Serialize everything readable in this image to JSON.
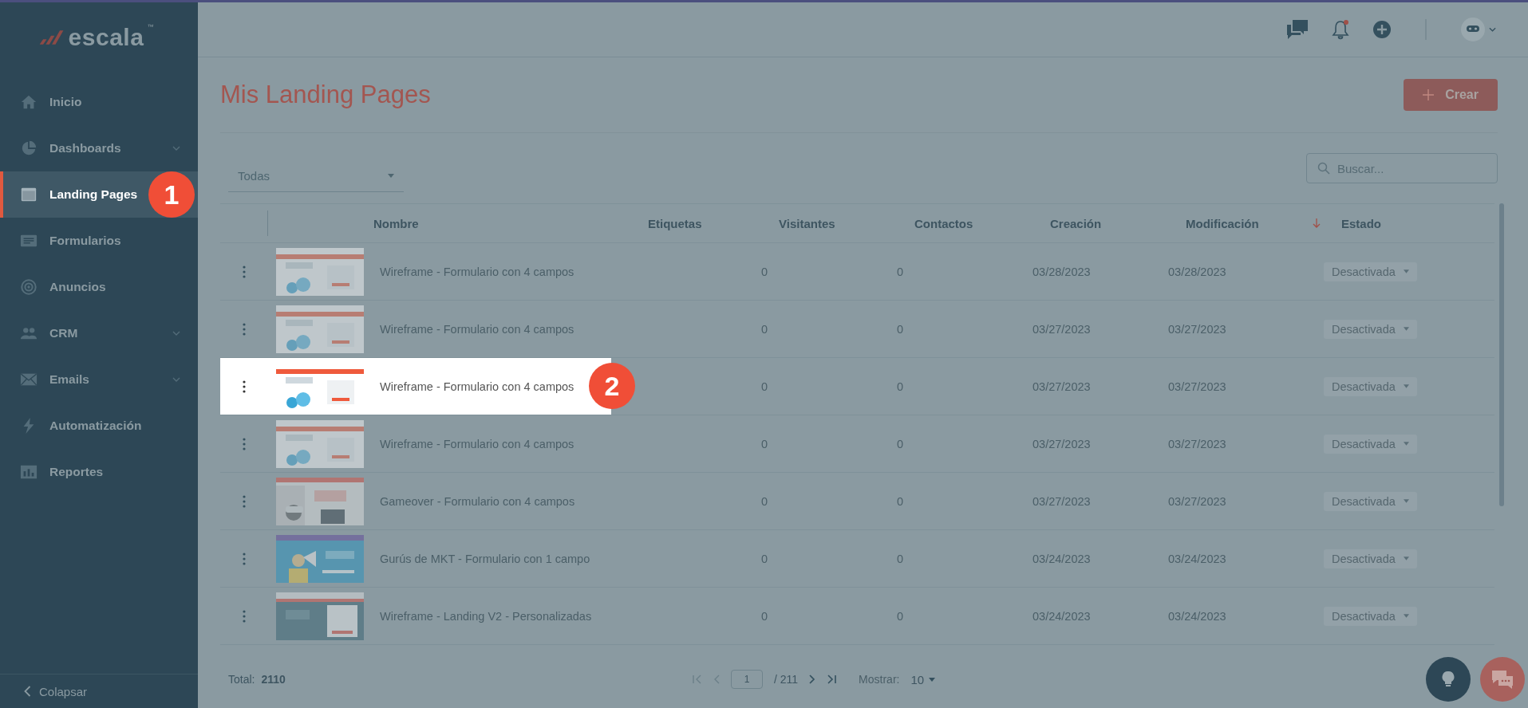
{
  "logo": {
    "text": "escala",
    "mark": "™"
  },
  "sidebar": {
    "items": [
      {
        "label": "Inicio",
        "expandable": false,
        "selected": false
      },
      {
        "label": "Dashboards",
        "expandable": true,
        "selected": false
      },
      {
        "label": "Landing Pages",
        "expandable": false,
        "selected": true
      },
      {
        "label": "Formularios",
        "expandable": false,
        "selected": false
      },
      {
        "label": "Anuncios",
        "expandable": false,
        "selected": false
      },
      {
        "label": "CRM",
        "expandable": true,
        "selected": false
      },
      {
        "label": "Emails",
        "expandable": true,
        "selected": false
      },
      {
        "label": "Automatización",
        "expandable": false,
        "selected": false
      },
      {
        "label": "Reportes",
        "expandable": false,
        "selected": false
      }
    ],
    "collapse": "Colapsar"
  },
  "callouts": [
    "1",
    "2"
  ],
  "page_title": "Mis Landing Pages",
  "create_button": "Crear",
  "filter": {
    "value": "Todas"
  },
  "search": {
    "placeholder": "Buscar..."
  },
  "table": {
    "columns": [
      {
        "label": "Nombre",
        "sorted": false
      },
      {
        "label": "Etiquetas",
        "sorted": false
      },
      {
        "label": "Visitantes",
        "sorted": false
      },
      {
        "label": "Contactos",
        "sorted": false
      },
      {
        "label": "Creación",
        "sorted": false
      },
      {
        "label": "Modificación",
        "sorted": true
      },
      {
        "label": "Estado",
        "sorted": false
      }
    ],
    "rows": [
      {
        "name": "Wireframe - Formulario con 4 campos",
        "visitors": "0",
        "contacts": "0",
        "created": "03/28/2023",
        "modified": "03/28/2023",
        "status": "Desactivada",
        "highlighted": false
      },
      {
        "name": "Wireframe - Formulario con 4 campos",
        "visitors": "0",
        "contacts": "0",
        "created": "03/27/2023",
        "modified": "03/27/2023",
        "status": "Desactivada",
        "highlighted": false
      },
      {
        "name": "Wireframe - Formulario con 4 campos",
        "visitors": "0",
        "contacts": "0",
        "created": "03/27/2023",
        "modified": "03/27/2023",
        "status": "Desactivada",
        "highlighted": true
      },
      {
        "name": "Wireframe - Formulario con 4 campos",
        "visitors": "0",
        "contacts": "0",
        "created": "03/27/2023",
        "modified": "03/27/2023",
        "status": "Desactivada",
        "highlighted": false
      },
      {
        "name": "Gameover - Formulario con 4 campos",
        "visitors": "0",
        "contacts": "0",
        "created": "03/27/2023",
        "modified": "03/27/2023",
        "status": "Desactivada",
        "highlighted": false
      },
      {
        "name": "Gurús de MKT - Formulario con 1 campo",
        "visitors": "0",
        "contacts": "0",
        "created": "03/24/2023",
        "modified": "03/24/2023",
        "status": "Desactivada",
        "highlighted": false
      },
      {
        "name": "Wireframe - Landing V2 - Personalizadas",
        "visitors": "0",
        "contacts": "0",
        "created": "03/24/2023",
        "modified": "03/24/2023",
        "status": "Desactivada",
        "highlighted": false
      }
    ]
  },
  "footer": {
    "total_label": "Total:",
    "total": "2110",
    "page": "1",
    "pages": "/ 211",
    "show_label": "Mostrar:",
    "page_size": "10"
  }
}
